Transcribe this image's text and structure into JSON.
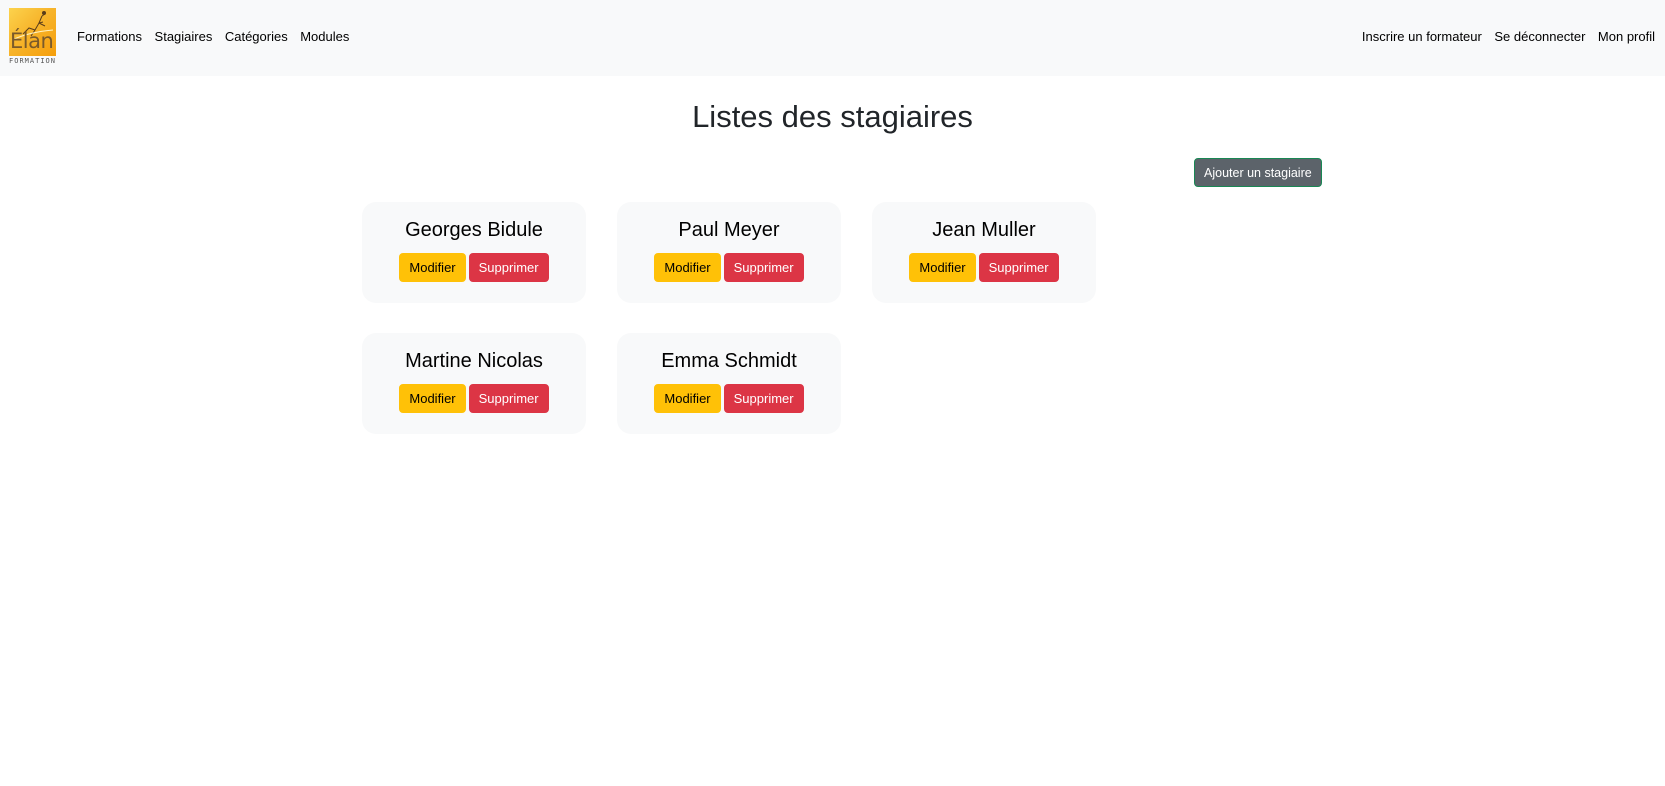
{
  "brand": {
    "logo_word": "Élan",
    "logo_sub": "FORMATION",
    "accent": "#f7b52c"
  },
  "nav": {
    "left": [
      "Formations",
      "Stagiaires",
      "Catégories",
      "Modules"
    ],
    "right": [
      "Inscrire un formateur",
      "Se déconnecter",
      "Mon profil"
    ]
  },
  "page": {
    "title": "Listes des stagiaires",
    "add_button": "Ajouter un stagiaire"
  },
  "actions": {
    "edit": "Modifier",
    "delete": "Supprimer"
  },
  "stagiaires": [
    {
      "name": "Georges Bidule"
    },
    {
      "name": "Paul Meyer"
    },
    {
      "name": "Jean Muller"
    },
    {
      "name": "Martine Nicolas"
    },
    {
      "name": "Emma Schmidt"
    }
  ],
  "colors": {
    "navbar_bg": "#f8f9fa",
    "warning": "#ffc107",
    "danger": "#dc3545",
    "secondary": "#5c636a"
  }
}
